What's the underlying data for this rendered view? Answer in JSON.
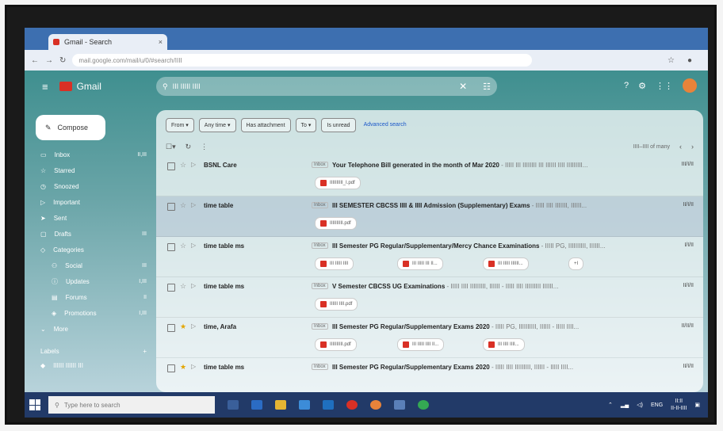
{
  "browser": {
    "tab_title": "Gmail - Search",
    "tab_close": "×",
    "url": "mail.google.com/mail/u/0/#search/IIII"
  },
  "gmail": {
    "logo_text": "Gmail",
    "search_query": "III IIIII IIII",
    "compose_label": "Compose"
  },
  "sidebar": {
    "items": [
      {
        "label": "Inbox",
        "count": "II,III"
      },
      {
        "label": "Starred",
        "count": ""
      },
      {
        "label": "Snoozed",
        "count": ""
      },
      {
        "label": "Important",
        "count": ""
      },
      {
        "label": "Sent",
        "count": ""
      },
      {
        "label": "Drafts",
        "count": "III"
      },
      {
        "label": "Categories",
        "count": ""
      },
      {
        "label": "Social",
        "count": "III"
      },
      {
        "label": "Updates",
        "count": "I,III"
      },
      {
        "label": "Forums",
        "count": "II"
      },
      {
        "label": "Promotions",
        "count": "I,III"
      },
      {
        "label": "More",
        "count": ""
      }
    ],
    "labels_heading": "Labels",
    "labels_plus": "+",
    "label_items": [
      {
        "label": "IIIIII IIIIII III"
      }
    ]
  },
  "filters": {
    "chips": [
      "From ▾",
      "Any time ▾",
      "Has attachment",
      "To ▾",
      "Is unread"
    ],
    "advanced": "Advanced search"
  },
  "list": {
    "pagination": "IIII–IIII of many",
    "rows": [
      {
        "from": "BSNL Care",
        "inbox": "Inbox",
        "subject": "Your Telephone Bill generated in the month of Mar 2020",
        "snippet": " - IIIII III IIIIIIII III IIIIII IIII IIIIIIIII...",
        "date": "III/I/II",
        "attachments": [
          "IIIIIIIIII_I.pdf"
        ]
      },
      {
        "from": "time table",
        "inbox": "Inbox",
        "subject": "III SEMESTER CBCSS IIII & IIII Admission (Supplementary) Exams",
        "snippet": " - IIIII IIII IIIIIII, IIIIII...",
        "date": "II/I/II",
        "attachments": [
          "IIIIIIIIII.pdf"
        ]
      },
      {
        "from": "time table ms",
        "inbox": "Inbox",
        "subject": "III Semester PG Regular/Supplementary/Mercy Chance Examinations",
        "snippet": " - IIIII PG, IIIIIIIIII, IIIIII...",
        "date": "I/I/II",
        "attachments": [
          "III IIIII IIII",
          "III IIIII III II...",
          "III IIIII IIIIII..."
        ],
        "more": "+I"
      },
      {
        "from": "time table ms",
        "inbox": "Inbox",
        "subject": "V Semester CBCSS UG Examinations",
        "snippet": " - IIIII IIII IIIIIIIII, IIIIII - IIIII IIII IIIIIIIII IIIIII...",
        "date": "II/I/II",
        "attachments": [
          "IIIIII IIII.pdf"
        ]
      },
      {
        "from": "time, Arafa",
        "inbox": "Inbox",
        "subject": "III Semester PG Regular/Supplementary Exams 2020",
        "snippet": " - IIIII PG, IIIIIIIIII, IIIIII - IIIII IIII...",
        "date": "II/II/II",
        "attachments": [
          "IIIIIIIIII.pdf",
          "III IIIII IIII II...",
          "III IIII IIII..."
        ]
      },
      {
        "from": "time table ms",
        "inbox": "Inbox",
        "subject": "III Semester PG Regular/Supplementary Exams 2020",
        "snippet": " - IIIII IIII IIIIIIIII, IIIIII - IIIII IIII...",
        "date": "II/I/II",
        "attachments": []
      }
    ]
  },
  "taskbar": {
    "search_placeholder": "Type here to search",
    "tray_lang": "ENG",
    "time": "II:II",
    "date": "II-II-IIII"
  }
}
